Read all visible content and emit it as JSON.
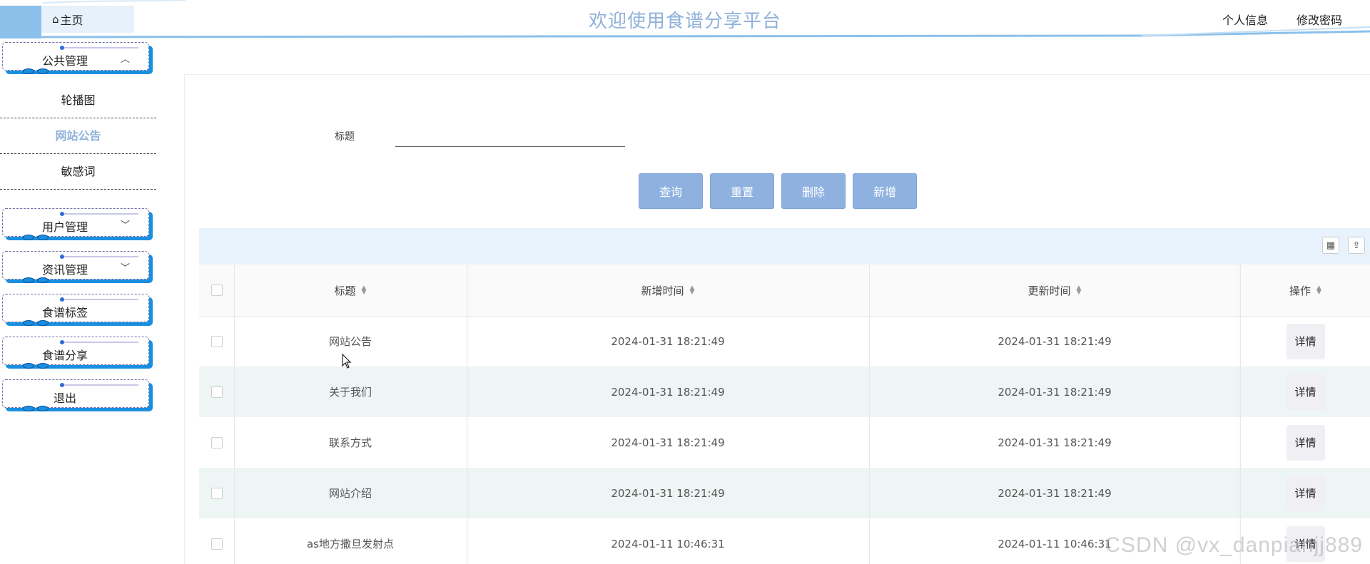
{
  "header": {
    "home_label": "主页",
    "title": "欢迎使用食谱分享平台",
    "profile_label": "个人信息",
    "password_label": "修改密码"
  },
  "sidebar": {
    "public_menu": "公共管理",
    "public_items": [
      "轮播图",
      "网站公告",
      "敏感词"
    ],
    "active_item": "网站公告",
    "user_menu": "用户管理",
    "news_menu": "资讯管理",
    "tags_menu": "食谱标签",
    "share_menu": "食谱分享",
    "logout": "退出"
  },
  "search": {
    "label": "标题",
    "value": ""
  },
  "buttons": {
    "query": "查询",
    "reset": "重置",
    "delete": "删除",
    "add": "新增"
  },
  "table": {
    "columns": [
      "标题",
      "新增时间",
      "更新时间",
      "操作"
    ],
    "rows": [
      {
        "title": "网站公告",
        "created": "2024-01-31 18:21:49",
        "updated": "2024-01-31 18:21:49",
        "action": "详情"
      },
      {
        "title": "关于我们",
        "created": "2024-01-31 18:21:49",
        "updated": "2024-01-31 18:21:49",
        "action": "详情"
      },
      {
        "title": "联系方式",
        "created": "2024-01-31 18:21:49",
        "updated": "2024-01-31 18:21:49",
        "action": "详情"
      },
      {
        "title": "网站介绍",
        "created": "2024-01-31 18:21:49",
        "updated": "2024-01-31 18:21:49",
        "action": "详情"
      },
      {
        "title": "as地方撒旦发射点",
        "created": "2024-01-11 10:46:31",
        "updated": "2024-01-11 10:46:31",
        "action": "详情"
      }
    ]
  },
  "watermark": "CSDN @vx_danpianjj889",
  "colors": {
    "accent": "#8eb1e0",
    "title": "#8fb2da",
    "menu_shadow": "#1a8fe0",
    "toolbar_bg": "#e8f2fc"
  }
}
